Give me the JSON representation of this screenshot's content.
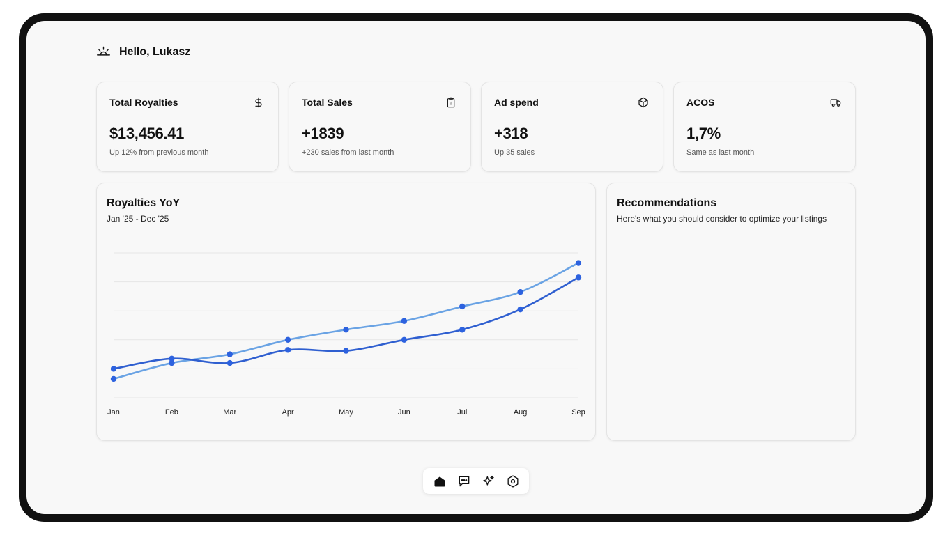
{
  "greeting": {
    "text": "Hello, Lukasz",
    "icon": "sunrise-icon"
  },
  "stats": [
    {
      "title": "Total Royalties",
      "value": "$13,456.41",
      "sub": "Up 12% from previous month",
      "icon": "dollar-icon"
    },
    {
      "title": "Total Sales",
      "value": "+1839",
      "sub": "+230 sales from last month",
      "icon": "clipboard-icon"
    },
    {
      "title": "Ad spend",
      "value": "+318",
      "sub": "Up 35 sales",
      "icon": "box-icon"
    },
    {
      "title": "ACOS",
      "value": "1,7%",
      "sub": "Same as last month",
      "icon": "truck-icon"
    }
  ],
  "chart": {
    "title": "Royalties YoY",
    "subtitle": "Jan '25 - Dec '25"
  },
  "chart_data": {
    "type": "line",
    "title": "Royalties YoY",
    "subtitle": "Jan '25 - Dec '25",
    "categories": [
      "Jan",
      "Feb",
      "Mar",
      "Apr",
      "May",
      "Jun",
      "Jul",
      "Aug",
      "Sep"
    ],
    "ylim": [
      0,
      5
    ],
    "grid": true,
    "series": [
      {
        "color": "#6aa3e4",
        "values": [
          0.65,
          1.2,
          1.5,
          2.0,
          2.35,
          2.65,
          3.15,
          3.65,
          4.65
        ]
      },
      {
        "color": "#2f5fd0",
        "values": [
          1.0,
          1.35,
          1.2,
          1.65,
          1.62,
          2.0,
          2.35,
          3.05,
          4.15
        ]
      }
    ]
  },
  "recommendations": {
    "title": "Recommendations",
    "subtitle": "Here's what you should consider to optimize your listings"
  },
  "dock": [
    {
      "name": "home-icon",
      "active": true
    },
    {
      "name": "chat-icon"
    },
    {
      "name": "sparkle-icon"
    },
    {
      "name": "settings-icon"
    }
  ]
}
